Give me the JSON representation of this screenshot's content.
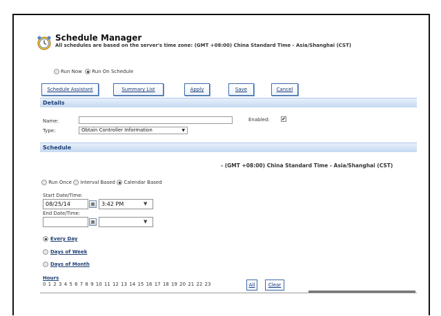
{
  "header": {
    "title": "Schedule Manager",
    "subtitle": "All schedules are based on the server's time zone: (GMT +08:00) China Standard Time - Asia/Shanghai (CST)",
    "icon": "clock-icon"
  },
  "run_mode": {
    "options": [
      "Run Now",
      "Run On Schedule"
    ],
    "selected": "Run On Schedule"
  },
  "toolbar": {
    "schedule_assistant": "Schedule Assistant",
    "summary_list": "Summary List",
    "apply": "Apply",
    "save": "Save",
    "cancel": "Cancel"
  },
  "details": {
    "section_title": "Details",
    "name_label": "Name:",
    "name_value": "",
    "enabled_label": "Enabled:",
    "enabled": true,
    "enabled_mark": "✔",
    "type_label": "Type:",
    "type_value": "Obtain Controller Information"
  },
  "schedule": {
    "section_title": "Schedule",
    "timezone": "- (GMT +08:00) China Standard Time - Asia/Shanghai (CST)",
    "types": [
      "Run Once",
      "Interval Based",
      "Calendar Based"
    ],
    "selected_type": "Calendar Based",
    "start_label": "Start Date/Time:",
    "start_date": "08/25/14",
    "start_time": "3:42 PM",
    "end_label": "End Date/Time:",
    "end_date": "",
    "end_time": "",
    "frequency": {
      "options": [
        "Every Day",
        "Days of Week",
        "Days of Month"
      ],
      "selected": "Every Day"
    },
    "hours_label": "Hours",
    "hours": "0 1 2 3 4 5 6 7 8 9 10 11 12 13 14 15 16 17 18 19 20 21 22 23",
    "all_label": "All",
    "clear_label": "Clear"
  },
  "colors": {
    "section_bar": "#c5d9f1",
    "link": "#1a3b7a",
    "button_border": "#3a6aa8"
  }
}
